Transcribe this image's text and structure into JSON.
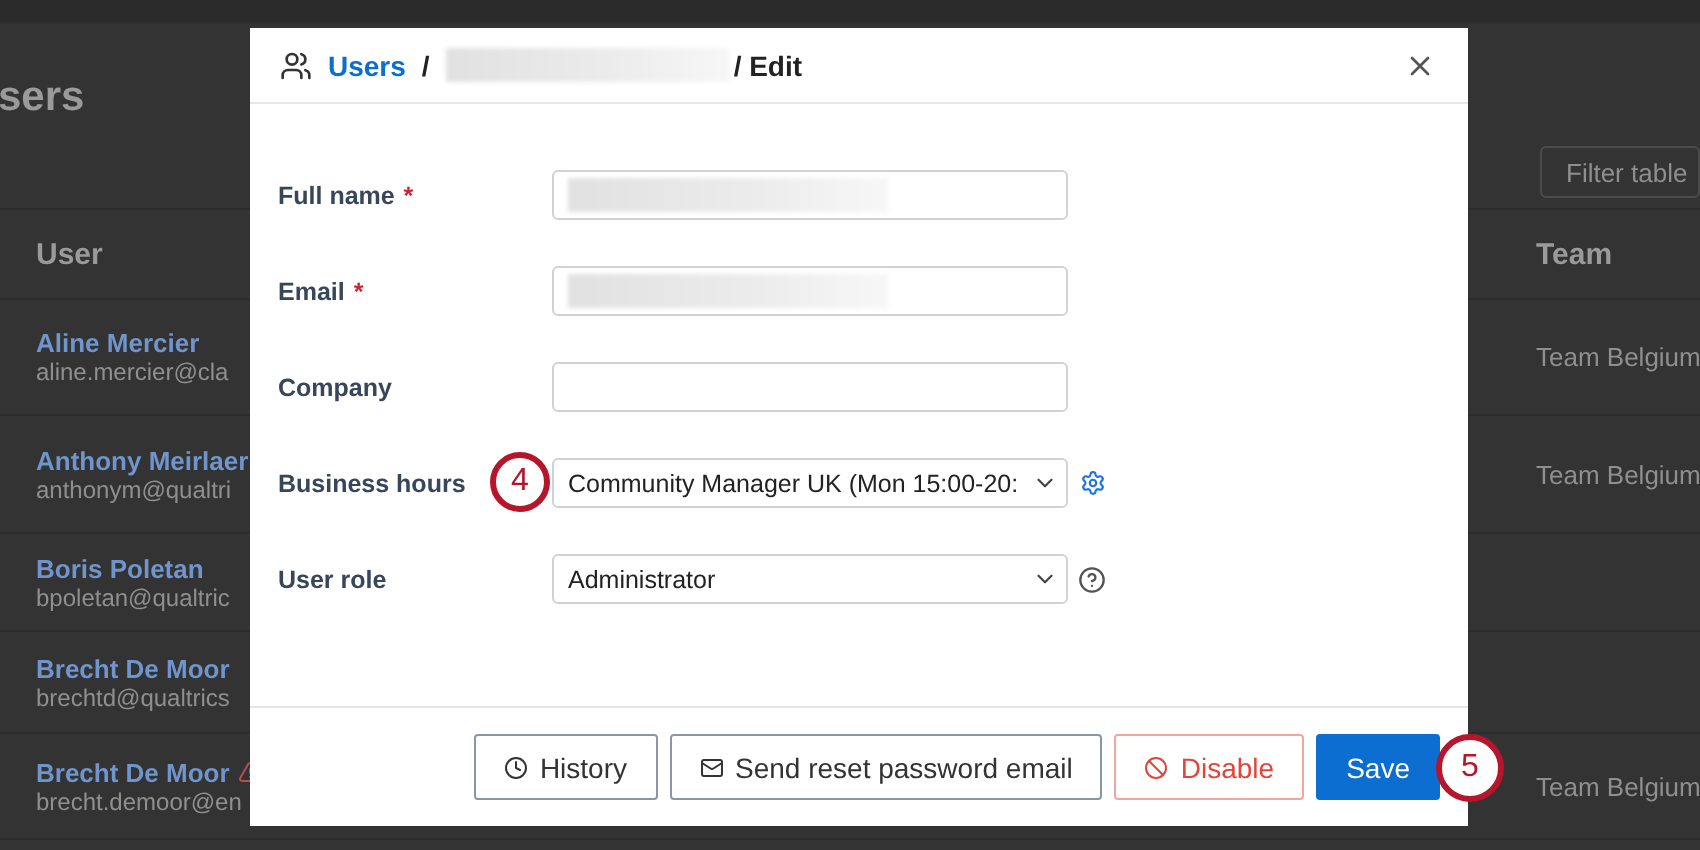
{
  "page": {
    "title": "sers",
    "filter": {
      "placeholder": "Filter table"
    },
    "columns": [
      "User",
      "Team"
    ],
    "rows": [
      {
        "name": "Aline Mercier",
        "email": "aline.mercier@cla",
        "team": "Team Belgium",
        "warning": false
      },
      {
        "name": "Anthony Meirlaer",
        "email": "anthonym@qualtri",
        "team": "Team Belgium",
        "warning": false
      },
      {
        "name": "Boris Poletan",
        "email": "bpoletan@qualtric",
        "team": "",
        "warning": false
      },
      {
        "name": "Brecht De Moor",
        "email": "brechtd@qualtrics",
        "team": "",
        "warning": false
      },
      {
        "name": "Brecht De Moor",
        "email": "brecht.demoor@en",
        "team": "Team Belgium",
        "warning": true
      }
    ]
  },
  "dialog": {
    "breadcrumb": {
      "link": "Users",
      "separator": "/",
      "current": "/ Edit"
    },
    "fields": [
      {
        "kind": "text",
        "label": "Full name",
        "required_mark": "*",
        "redacted": true
      },
      {
        "kind": "text",
        "label": "Email",
        "required_mark": "*",
        "redacted": true
      },
      {
        "kind": "text",
        "label": "Company",
        "redacted": false
      },
      {
        "kind": "select",
        "label": "Business hours",
        "value": "Community Manager UK (Mon 15:00-20:",
        "settings_icon": true,
        "callout": "4"
      },
      {
        "kind": "select",
        "label": "User role",
        "value": "Administrator",
        "help_icon": true
      }
    ],
    "buttons": [
      {
        "kind": "history",
        "label": "History"
      },
      {
        "kind": "mail",
        "label": "Send reset password email"
      },
      {
        "kind": "danger",
        "label": "Disable"
      },
      {
        "kind": "primary",
        "label": "Save",
        "callout": "5"
      }
    ]
  }
}
